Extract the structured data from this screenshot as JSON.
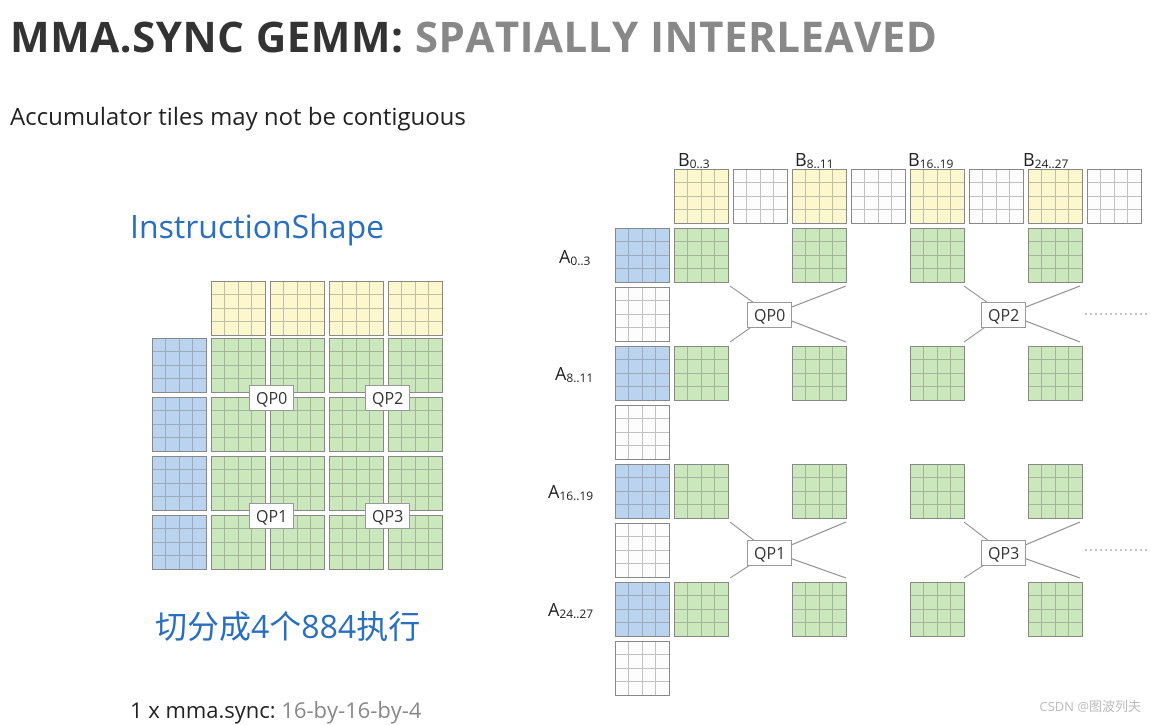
{
  "title_part1": "MMA.SYNC GEMM: ",
  "title_part2": "SPATIALLY INTERLEAVED",
  "subtitle": "Accumulator tiles may not be contiguous",
  "instruction_shape": "InstructionShape",
  "chinese_text": "切分成4个884执行",
  "mma_label": "1 x mma.sync:",
  "mma_value": " 16-by-16-by-4",
  "watermark": "CSDN @图波列夫",
  "qp": {
    "qp0": "QP0",
    "qp1": "QP1",
    "qp2": "QP2",
    "qp3": "QP3"
  },
  "left_diagram": {
    "top_row_tiles": 4,
    "side_col_tiles": 4,
    "body_tiles": "4x4",
    "qp_tl": "QP0",
    "qp_tr": "QP2",
    "qp_bl": "QP1",
    "qp_br": "QP3"
  },
  "right_diagram": {
    "B_labels": [
      "B0..3",
      "B8..11",
      "B16..19",
      "B24..27"
    ],
    "A_labels": [
      "A0..3",
      "A8..11",
      "A16..19",
      "A24..27"
    ],
    "quad_labels": [
      "QP0",
      "QP2",
      "QP1",
      "QP3"
    ]
  }
}
